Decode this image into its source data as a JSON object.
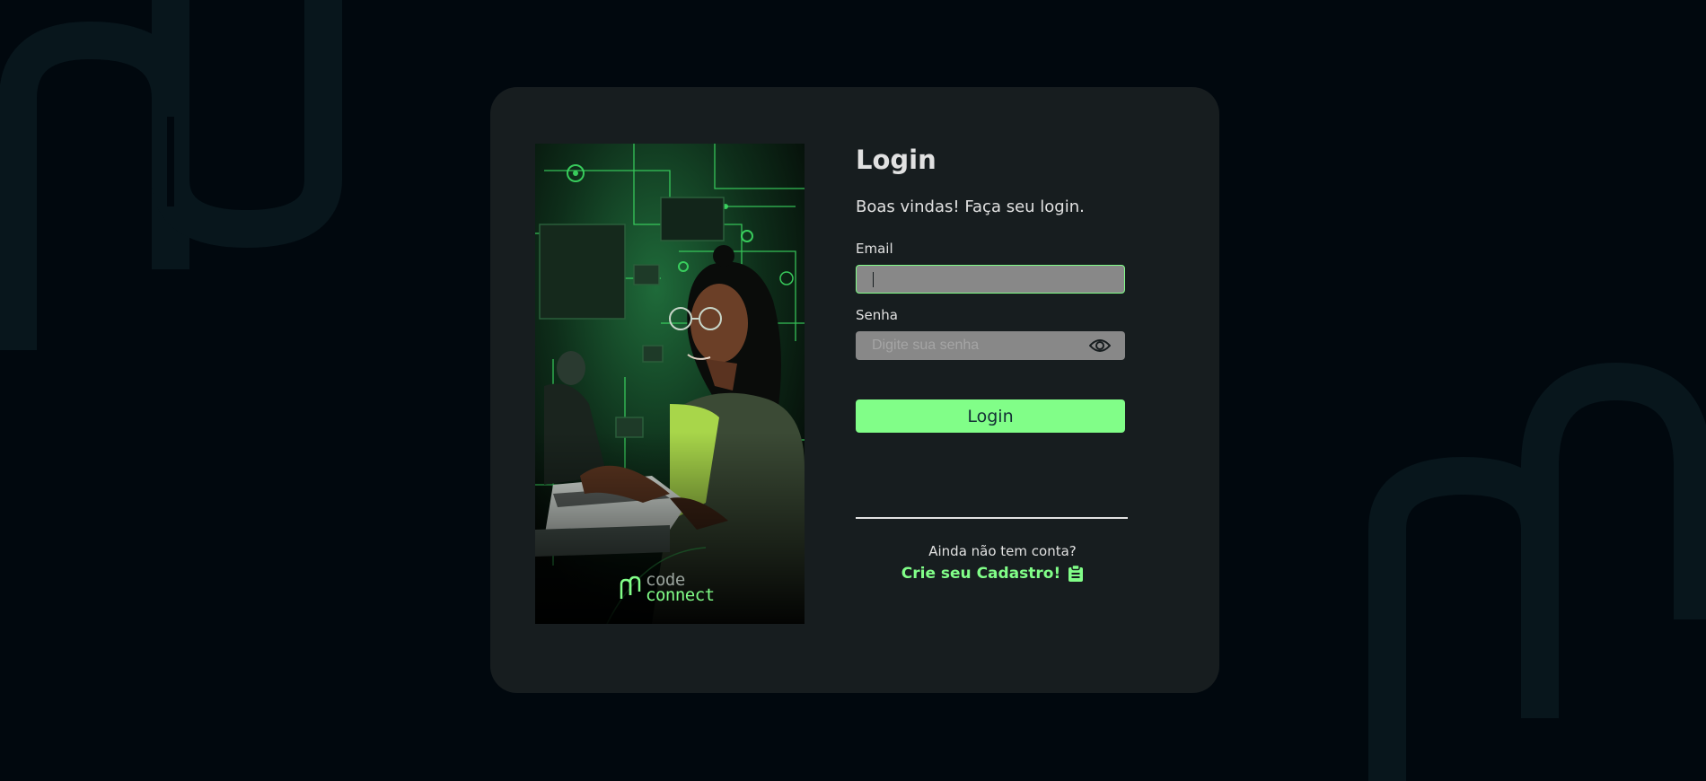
{
  "form": {
    "title": "Login",
    "subtitle": "Boas vindas! Faça seu login.",
    "email_label": "Email",
    "email_value": "",
    "password_label": "Senha",
    "password_placeholder": "Digite sua senha",
    "login_button": "Login"
  },
  "signup": {
    "question": "Ainda não tem conta?",
    "link": "Crie seu Cadastro!"
  },
  "brand": {
    "logo_line1": "code",
    "logo_line2": "connect"
  },
  "icons": {
    "password_toggle": "eye-icon",
    "signup_icon": "clipboard-icon",
    "logo_mark": "chain-link-icon"
  },
  "colors": {
    "background": "#01080E",
    "card": "#171D1F",
    "accent": "#81FE88",
    "input": "#888888",
    "text": "#E1E1E1"
  }
}
